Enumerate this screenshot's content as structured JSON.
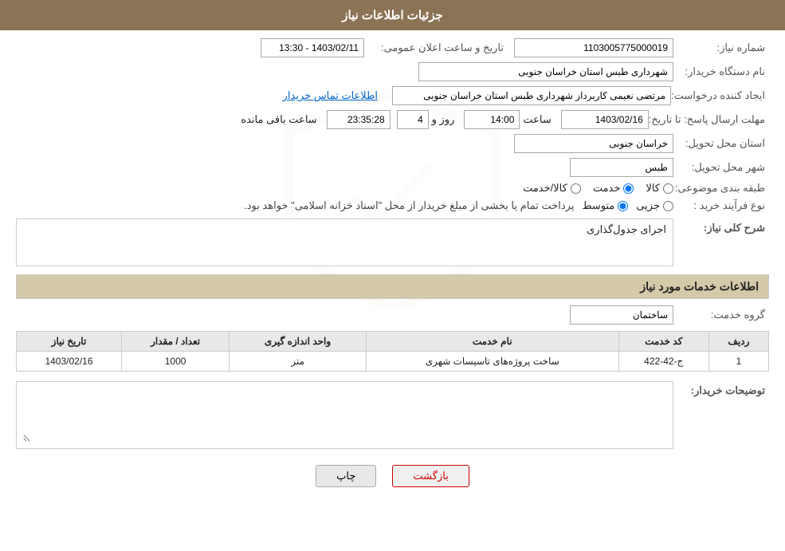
{
  "header": {
    "title": "جزئیات اطلاعات نیاز"
  },
  "form": {
    "need_number_label": "شماره نیاز:",
    "need_number_value": "1103005775000019",
    "announcement_date_label": "تاریخ و ساعت اعلان عمومی:",
    "announcement_date_value": "1403/02/11 - 13:30",
    "buyer_org_label": "نام دستگاه خریدار:",
    "buyer_org_value": "شهرداری طبس استان خراسان جنوبی",
    "creator_label": "ایجاد کننده درخواست:",
    "creator_value": "مرتضی نعیمی کاربرداز شهرداری طبس استان خراسان جنوبی",
    "contact_link": "اطلاعات تماس خریدار",
    "deadline_label": "مهلت ارسال پاسخ: تا تاریخ:",
    "deadline_date": "1403/02/16",
    "deadline_time_label": "ساعت",
    "deadline_time": "14:00",
    "deadline_days_label": "روز و",
    "deadline_days": "4",
    "deadline_remaining_label": "ساعت باقی مانده",
    "deadline_remaining": "23:35:28",
    "province_label": "استان محل تحویل:",
    "province_value": "خراسان جنوبی",
    "city_label": "شهر محل تحویل:",
    "city_value": "طبس",
    "category_label": "طبقه بندی موضوعی:",
    "category_options": [
      "کالا",
      "خدمت",
      "کالا/خدمت"
    ],
    "category_selected": "خدمت",
    "purchase_type_label": "نوع فرآیند خرید :",
    "purchase_type_options": [
      "جزیی",
      "متوسط"
    ],
    "purchase_type_selected": "متوسط",
    "purchase_type_note": "پرداخت تمام یا بخشی از مبلغ خریدار از محل \"اسناد خزانه اسلامی\" خواهد بود.",
    "general_desc_label": "شرح کلی نیاز:",
    "general_desc_value": "اجرای جدول‌گذاری",
    "services_section_title": "اطلاعات خدمات مورد نیاز",
    "service_group_label": "گروه خدمت:",
    "service_group_value": "ساختمان",
    "table_headers": [
      "ردیف",
      "کد خدمت",
      "نام خدمت",
      "واحد اندازه گیری",
      "تعداد / مقدار",
      "تاریخ نیاز"
    ],
    "table_rows": [
      {
        "row": "1",
        "code": "ج-42-422",
        "name": "ساخت پروژه‌های تاسیسات شهری",
        "unit": "متر",
        "quantity": "1000",
        "date": "1403/02/16"
      }
    ],
    "buyer_desc_label": "توضیحات خریدار:",
    "buyer_desc_value": "",
    "btn_print": "چاپ",
    "btn_back": "بازگشت"
  },
  "watermark_text": "AhaTender.net"
}
